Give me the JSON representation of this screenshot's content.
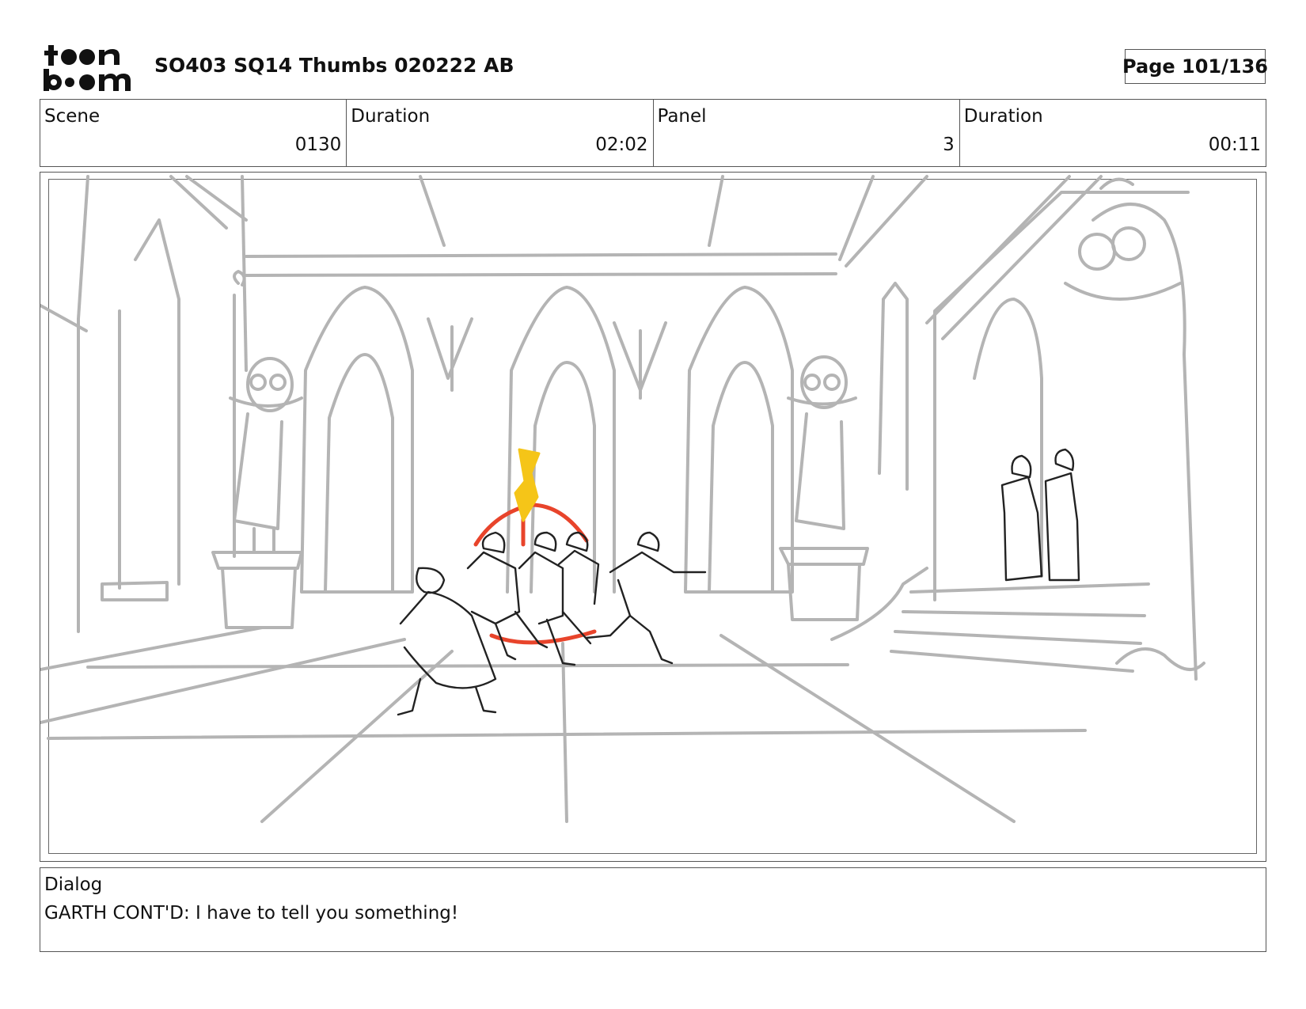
{
  "header": {
    "logo_text": "toon boom",
    "title": "SO403 SQ14 Thumbs 020222 AB",
    "page": "Page 101/136"
  },
  "info": {
    "scene_label": "Scene",
    "scene_value": "0130",
    "scene_duration_label": "Duration",
    "scene_duration_value": "02:02",
    "panel_label": "Panel",
    "panel_value": "3",
    "panel_duration_label": "Duration",
    "panel_duration_value": "00:11"
  },
  "dialog": {
    "label": "Dialog",
    "text": "GARTH CONT'D: I have to tell you something!"
  },
  "colors": {
    "sketch_gray": "#b4b4b4",
    "ink": "#222222",
    "fire_red": "#e8442b",
    "fire_yellow": "#f5c518"
  }
}
